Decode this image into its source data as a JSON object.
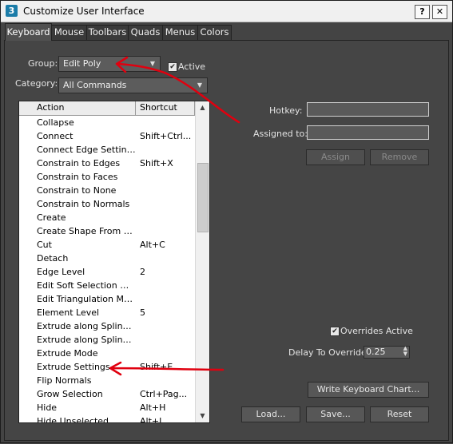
{
  "window": {
    "title": "Customize User Interface",
    "app_icon_glyph": "3",
    "help_label": "?",
    "close_label": "✕"
  },
  "tabs": [
    {
      "label": "Keyboard",
      "active": true
    },
    {
      "label": "Mouse"
    },
    {
      "label": "Toolbars"
    },
    {
      "label": "Quads"
    },
    {
      "label": "Menus"
    },
    {
      "label": "Colors"
    }
  ],
  "group": {
    "label": "Group:",
    "value": "Edit Poly"
  },
  "active_checkbox": {
    "label": "Active",
    "checked": true
  },
  "category": {
    "label": "Category:",
    "value": "All Commands"
  },
  "list": {
    "columns": [
      "Action",
      "Shortcut"
    ],
    "rows": [
      {
        "action": "Collapse",
        "shortcut": ""
      },
      {
        "action": "Connect",
        "shortcut": "Shift+Ctrl..."
      },
      {
        "action": "Connect Edge Settings",
        "shortcut": ""
      },
      {
        "action": "Constrain to Edges",
        "shortcut": "Shift+X"
      },
      {
        "action": "Constrain to Faces",
        "shortcut": ""
      },
      {
        "action": "Constrain to None",
        "shortcut": ""
      },
      {
        "action": "Constrain to Normals",
        "shortcut": ""
      },
      {
        "action": "Create",
        "shortcut": ""
      },
      {
        "action": "Create Shape From Ed...",
        "shortcut": ""
      },
      {
        "action": "Cut",
        "shortcut": "Alt+C"
      },
      {
        "action": "Detach",
        "shortcut": ""
      },
      {
        "action": "Edge Level",
        "shortcut": "2"
      },
      {
        "action": "Edit Soft Selection Mode",
        "shortcut": ""
      },
      {
        "action": "Edit Triangulation Mode",
        "shortcut": ""
      },
      {
        "action": "Element Level",
        "shortcut": "5"
      },
      {
        "action": "Extrude along Spline M...",
        "shortcut": ""
      },
      {
        "action": "Extrude along Spline S...",
        "shortcut": ""
      },
      {
        "action": "Extrude Mode",
        "shortcut": ""
      },
      {
        "action": "Extrude Settings",
        "shortcut": "Shift+E"
      },
      {
        "action": "Flip Normals",
        "shortcut": ""
      },
      {
        "action": "Grow Selection",
        "shortcut": "Ctrl+Pag..."
      },
      {
        "action": "Hide",
        "shortcut": "Alt+H"
      },
      {
        "action": "Hide Unselected",
        "shortcut": "Alt+I"
      }
    ]
  },
  "hotkey": {
    "label": "Hotkey:",
    "value": ""
  },
  "assigned_to": {
    "label": "Assigned to:",
    "value": ""
  },
  "buttons": {
    "assign": "Assign",
    "remove": "Remove",
    "write_chart": "Write Keyboard Chart...",
    "load": "Load...",
    "save": "Save...",
    "reset": "Reset"
  },
  "overrides": {
    "label": "Overrides Active",
    "checked": true
  },
  "delay": {
    "label": "Delay To Override:",
    "value": "0.25"
  },
  "annotation_color": "#e0000f"
}
